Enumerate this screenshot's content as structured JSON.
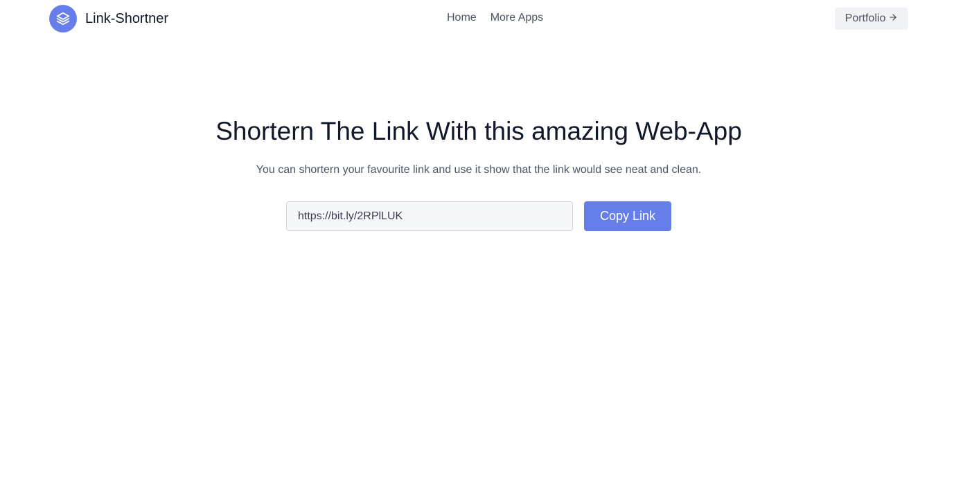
{
  "colors": {
    "accent": "#667eea",
    "heading": "#111827",
    "body_text": "#4b5563",
    "input_bg": "#f5f7fa",
    "secondary_btn_bg": "#f0f2f5"
  },
  "header": {
    "logo_icon": "stack-layers-icon",
    "brand_name": "Link-Shortner",
    "nav": [
      {
        "label": "Home"
      },
      {
        "label": "More Apps"
      }
    ],
    "portfolio_button": {
      "label": "Portfolio",
      "icon": "arrow-right-icon"
    }
  },
  "hero": {
    "title": "Shortern The Link With this amazing Web-App",
    "subtitle": "You can shortern your favourite link and use it show that the link would see neat and clean."
  },
  "shortener": {
    "link_value": "https://bit.ly/2RPlLUK",
    "copy_button_label": "Copy Link"
  }
}
